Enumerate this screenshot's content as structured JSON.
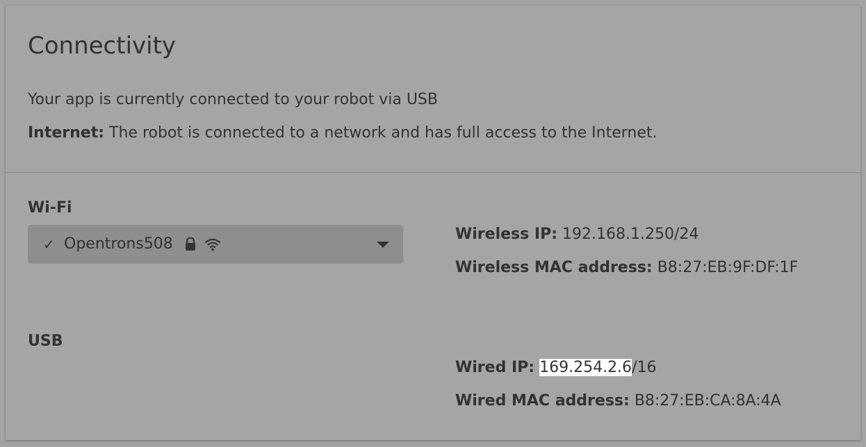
{
  "connectivity": {
    "title": "Connectivity",
    "status_text": "Your app is currently connected to your robot via USB",
    "internet_label": "Internet:",
    "internet_text": " The robot is connected to a network and has full access to the Internet."
  },
  "wifi": {
    "label": "Wi-Fi",
    "selected_network": "Opentrons508",
    "check_glyph": "✓",
    "icons": [
      "check-icon",
      "lock-icon",
      "wifi-icon",
      "chevron-down-icon"
    ],
    "wireless_ip_label": "Wireless IP:",
    "wireless_ip_value": "192.168.1.250/24",
    "wireless_mac_label": "Wireless MAC address:",
    "wireless_mac_value": "B8:27:EB:9F:DF:1F"
  },
  "usb": {
    "label": "USB",
    "wired_ip_label": "Wired IP:",
    "wired_ip_highlighted": "169.254.2.6",
    "wired_ip_suffix": "/16",
    "wired_mac_label": "Wired MAC address:",
    "wired_mac_value": "B8:27:EB:CA:8A:4A"
  },
  "colors": {
    "background": "#a5a5a5",
    "dropdown_bg": "#8e8e8e",
    "text": "#333333",
    "highlight": "#ffffff"
  }
}
